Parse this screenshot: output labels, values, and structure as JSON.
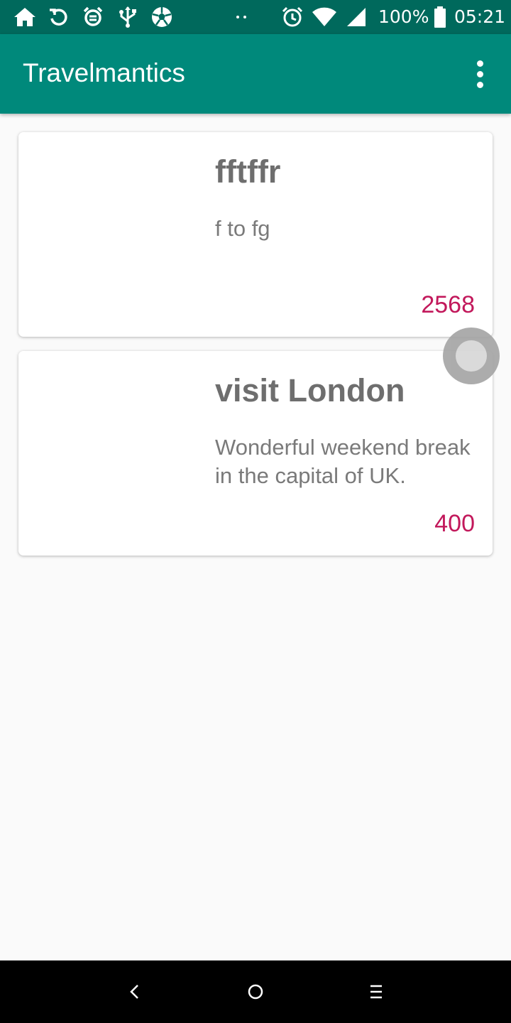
{
  "status_bar": {
    "battery_text": "100%",
    "time": "05:21",
    "left_icons": [
      "home-icon",
      "sync-icon",
      "alarm-clock-icon",
      "usb-icon",
      "soccer-ball-icon"
    ],
    "right_icons": [
      "alarm-icon",
      "wifi-icon",
      "cell-signal-icon",
      "battery-icon"
    ]
  },
  "app_bar": {
    "title": "Travelmantics",
    "menu_icon": "overflow-menu-icon"
  },
  "deals": [
    {
      "title": "fftffr",
      "description": "f to fg",
      "price": "2568"
    },
    {
      "title": "visit London",
      "description": "Wonderful weekend break in the capital of UK.",
      "price": "400"
    }
  ],
  "nav_bar": {
    "icons": [
      "back-icon",
      "home-button-icon",
      "recents-icon"
    ]
  },
  "colors": {
    "status_bar": "#00695c",
    "app_bar": "#00897b",
    "price": "#c2185b",
    "card_text": "#6e6e6e",
    "background": "#fafafa"
  }
}
